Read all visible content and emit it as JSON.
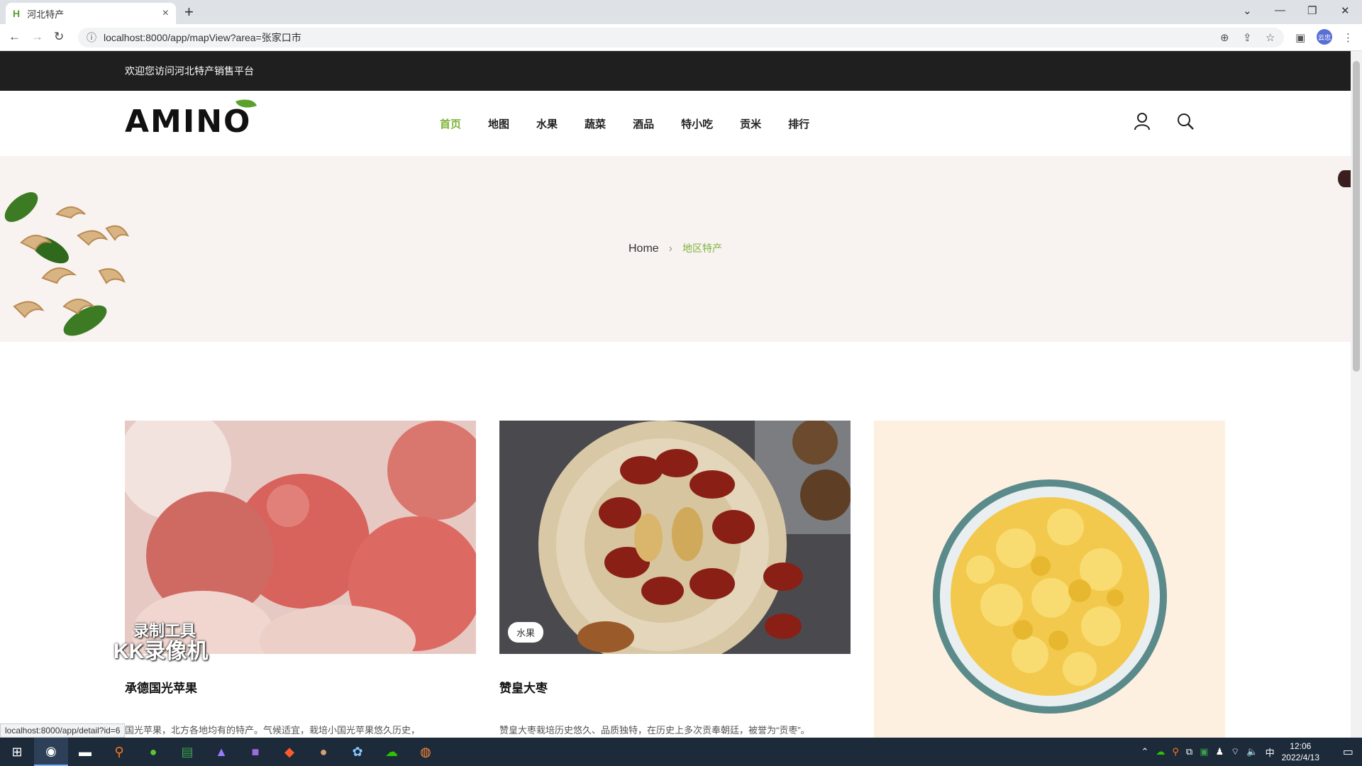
{
  "browser": {
    "tab_title": "河北特产",
    "url": "localhost:8000/app/mapView?area=张家口市",
    "profile_label": "云忠",
    "status_url": "localhost:8000/app/detail?id=6"
  },
  "site": {
    "welcome": "欢迎您访问河北特产销售平台",
    "logo": "AMINO",
    "nav": [
      {
        "label": "首页",
        "active": true
      },
      {
        "label": "地图",
        "active": false
      },
      {
        "label": "水果",
        "active": false
      },
      {
        "label": "蔬菜",
        "active": false
      },
      {
        "label": "酒品",
        "active": false
      },
      {
        "label": "特小吃",
        "active": false
      },
      {
        "label": "贡米",
        "active": false
      },
      {
        "label": "排行",
        "active": false
      }
    ]
  },
  "breadcrumb": {
    "home": "Home",
    "current": "地区特产"
  },
  "products": [
    {
      "title": "承德国光苹果",
      "desc": "国光苹果，北方各地均有的特产。气候适宜，栽培小国光苹果悠久历史，",
      "tag": ""
    },
    {
      "title": "赞皇大枣",
      "desc": "赞皇大枣栽培历史悠久、品质独特，在历史上多次贡奉朝廷，被誉为“贡枣”。",
      "tag": "水果"
    },
    {
      "title": "",
      "desc": "",
      "tag": ""
    }
  ],
  "watermark": {
    "line1": "录制工具",
    "line2": "KK录像机"
  },
  "taskbar": {
    "time": "12:06",
    "date": "2022/4/13",
    "ime": "中"
  },
  "colors": {
    "accent": "#7fb33c",
    "topbar": "#1f1f1f",
    "hero_bg": "#f8f3f0"
  }
}
